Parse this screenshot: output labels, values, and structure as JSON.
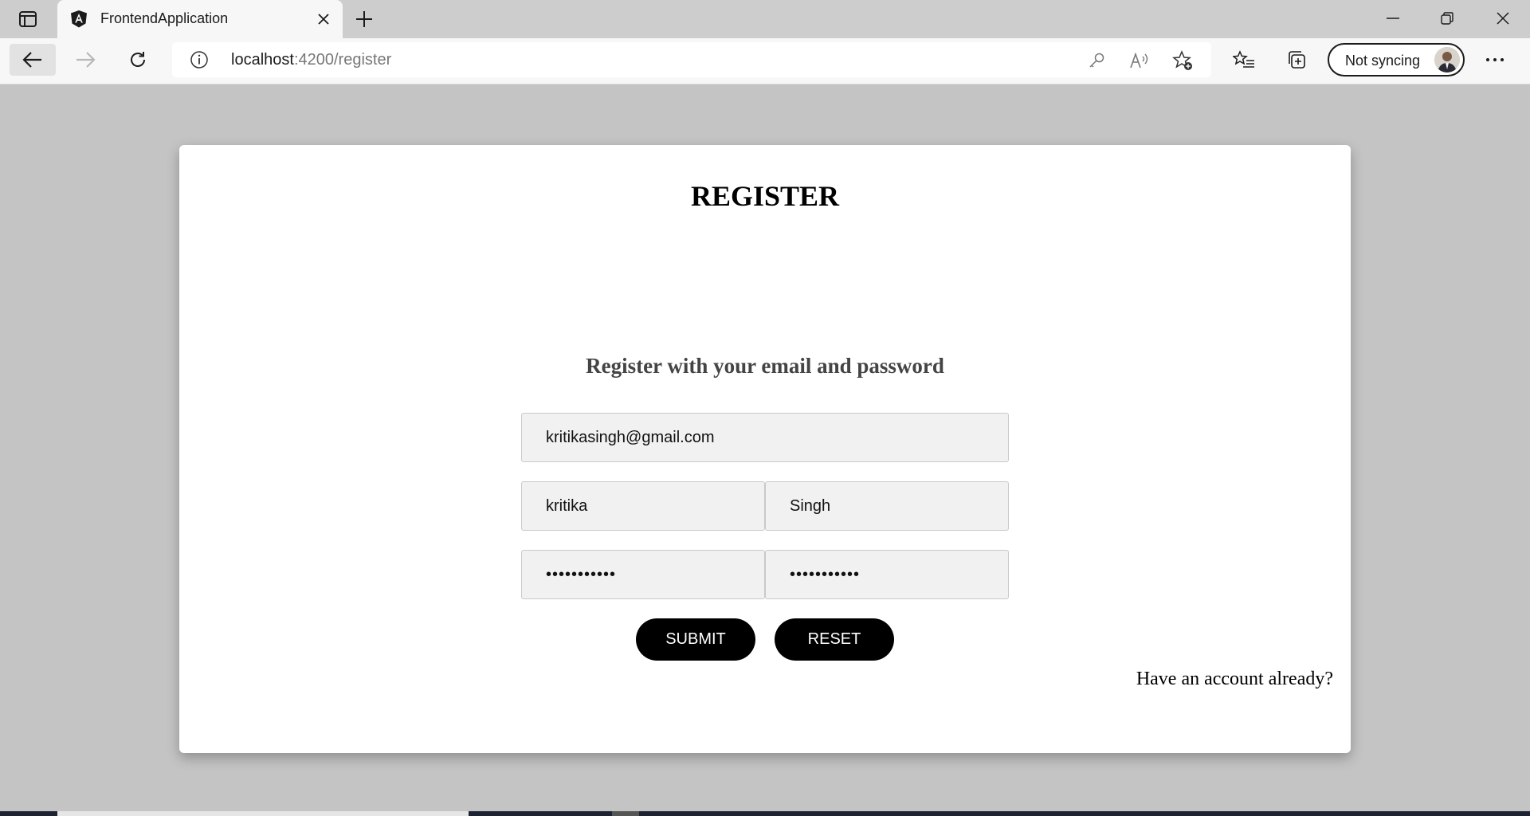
{
  "browser": {
    "tab_title": "FrontendApplication",
    "url_host": "localhost",
    "url_path": ":4200/register",
    "profile_label": "Not syncing"
  },
  "page": {
    "title": "REGISTER",
    "subtitle": "Register with your email and password",
    "form": {
      "email_value": "kritikasingh@gmail.com",
      "first_name_value": "kritika",
      "last_name_value": "Singh",
      "password_value": "kritika1234",
      "confirm_password_value": "kritika1234"
    },
    "submit_label": "SUBMIT",
    "reset_label": "RESET",
    "login_link": "Have an account already?"
  },
  "colors": {
    "page_background": "#c4c4c4",
    "button_background": "#000000"
  }
}
